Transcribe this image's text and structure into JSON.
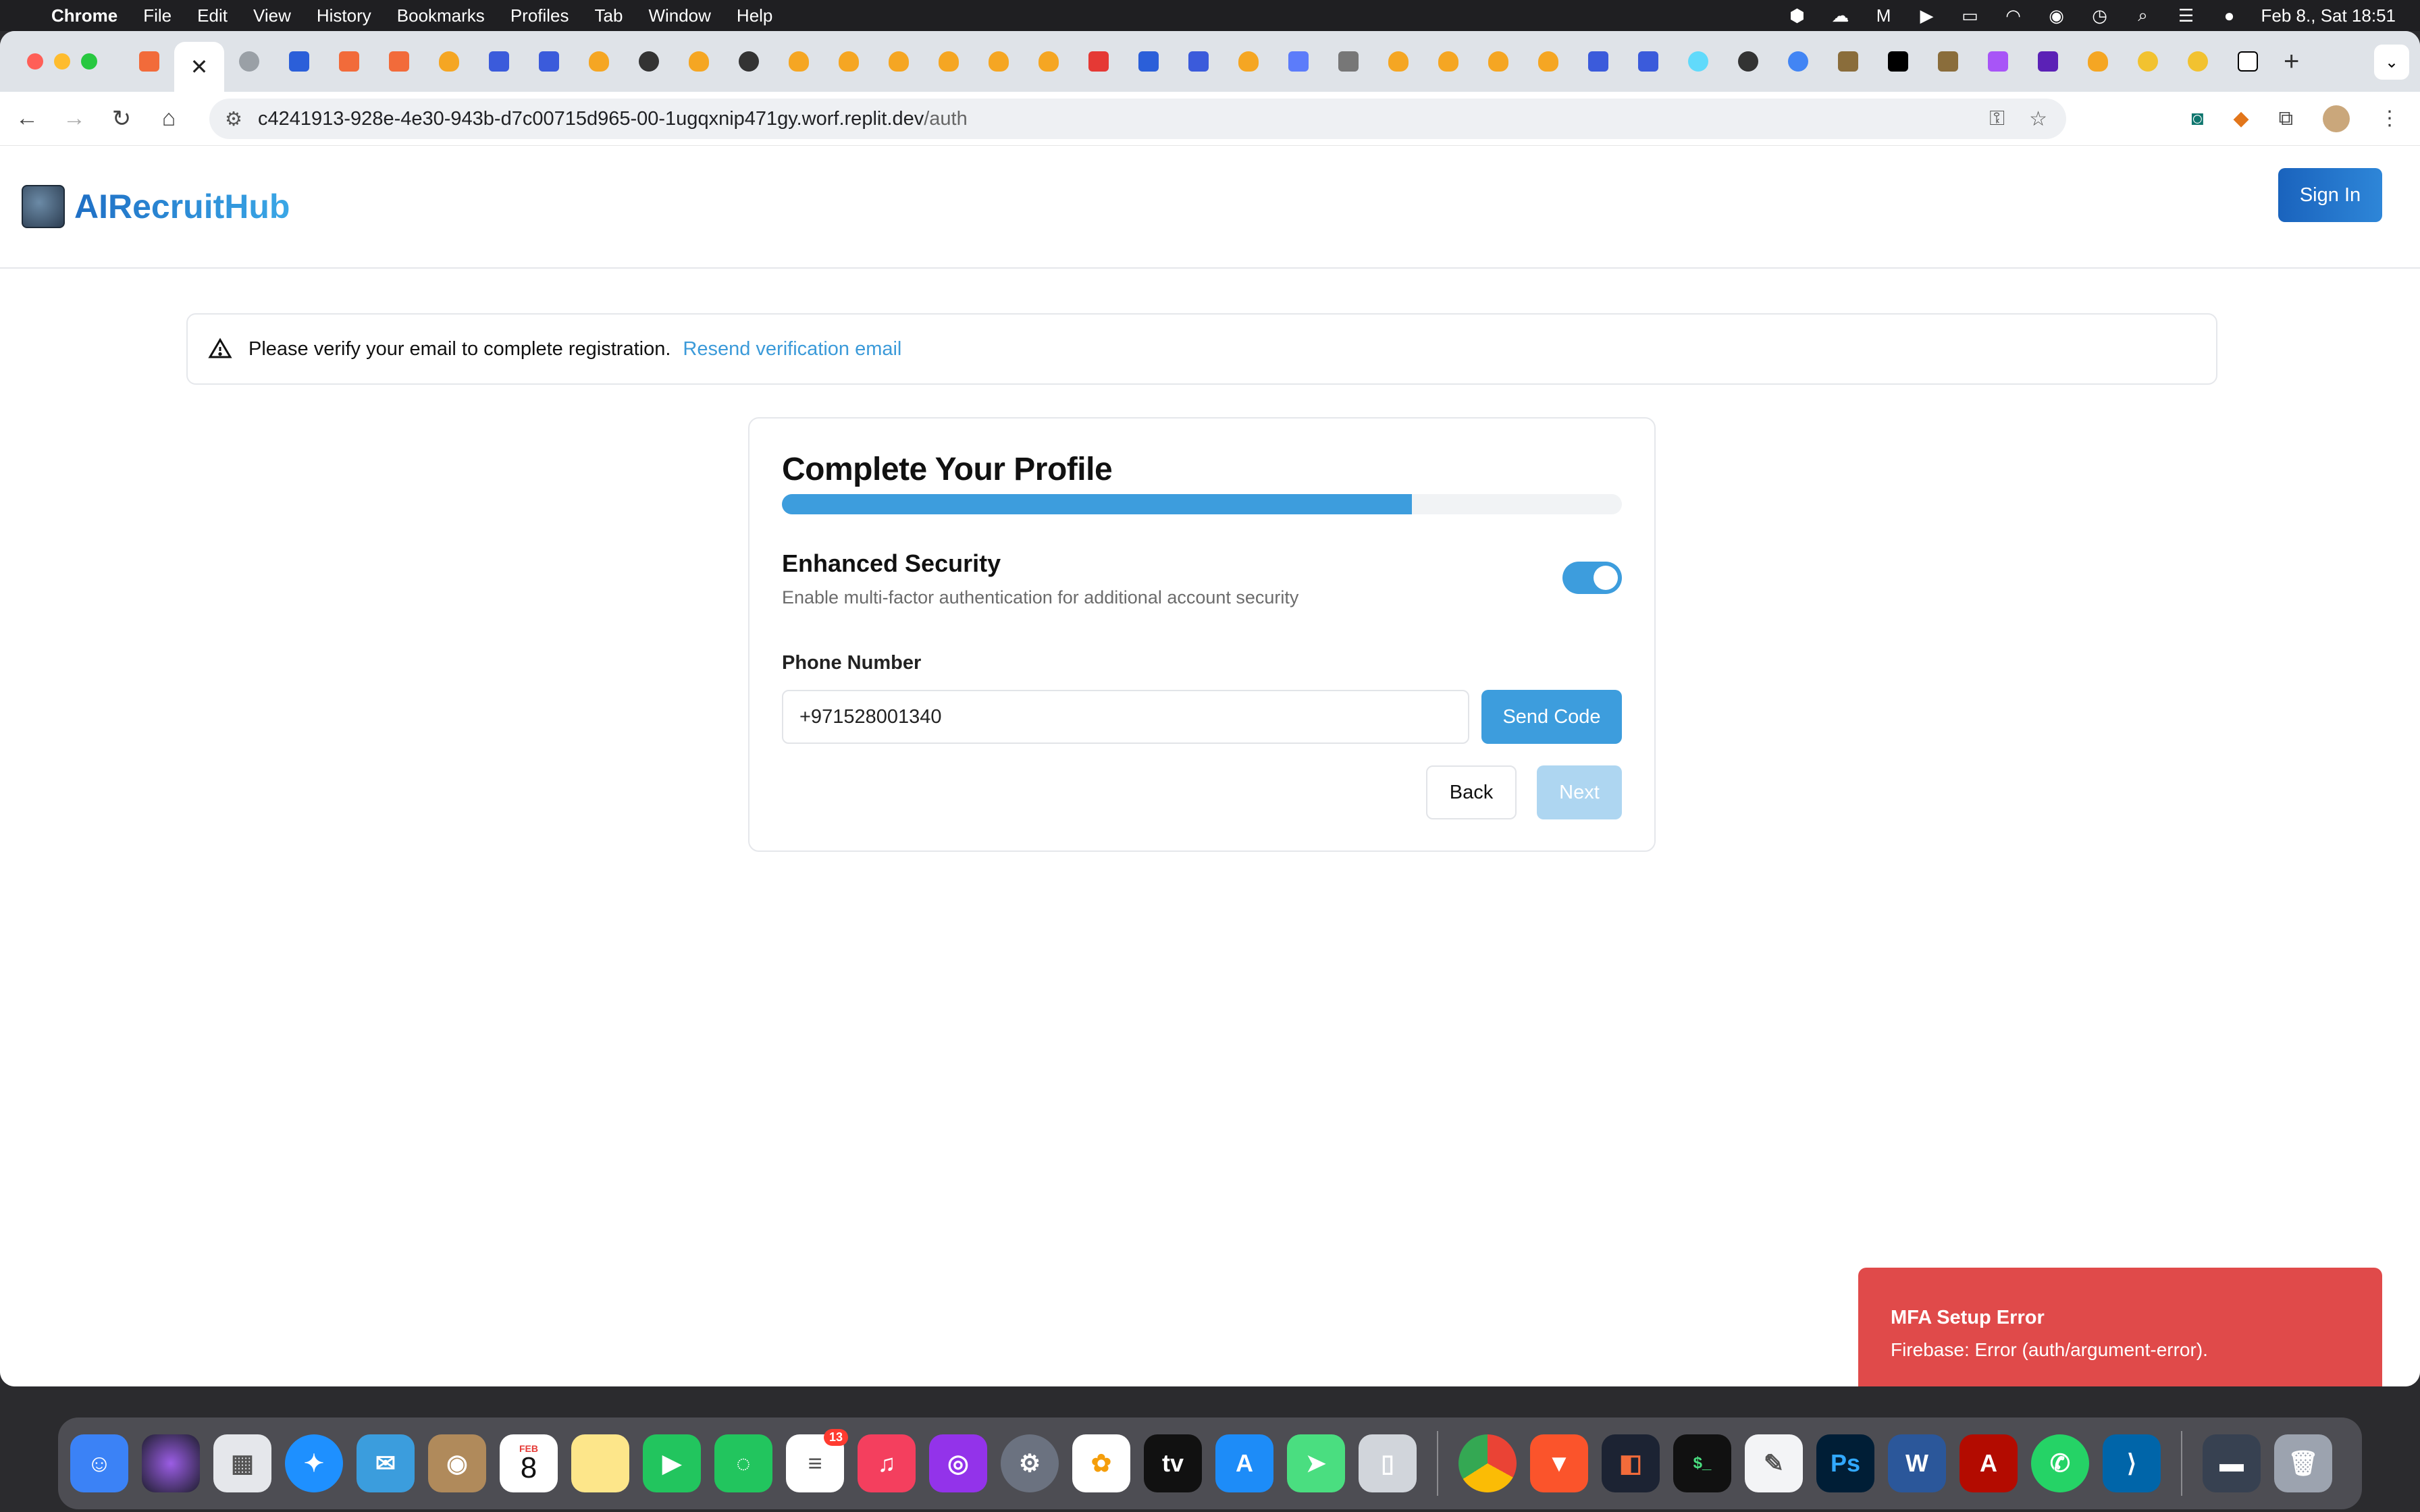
{
  "menubar": {
    "app_name": "Chrome",
    "items": [
      "File",
      "Edit",
      "View",
      "History",
      "Bookmarks",
      "Profiles",
      "Tab",
      "Window",
      "Help"
    ],
    "datetime": "Feb 8., Sat  18:51"
  },
  "browser": {
    "url_host": "c4241913-928e-4e30-943b-d7c00715d965-00-1ugqxnip471gy.worf.replit.dev",
    "url_path": "/auth"
  },
  "app": {
    "brand": "AIRecruitHub",
    "signin_label": "Sign In",
    "alert": {
      "message": "Please verify your email to complete registration.",
      "link": "Resend verification email"
    },
    "card": {
      "title": "Complete Your Profile",
      "progress": 0.75,
      "section_title": "Enhanced Security",
      "section_desc": "Enable multi-factor authentication for additional account security",
      "mfa_enabled": true,
      "phone_label": "Phone Number",
      "phone_value": "+971528001340",
      "send_code_label": "Send Code",
      "back_label": "Back",
      "next_label": "Next"
    },
    "toast": {
      "title": "MFA Setup Error",
      "message": "Firebase: Error (auth/argument-error)."
    }
  },
  "dock": {
    "calendar_month": "FEB",
    "calendar_day": "8",
    "reminders_badge": "13"
  },
  "colors": {
    "accent": "#3d9ddd",
    "error": "#e04a4a",
    "brand": "#1f6fc5"
  }
}
